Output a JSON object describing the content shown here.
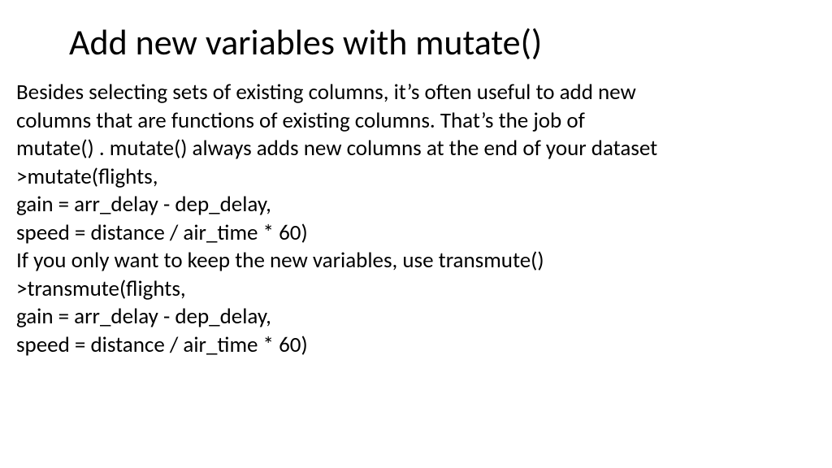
{
  "title": "Add new variables with mutate()",
  "lines": [
    "Besides selecting sets of existing columns, it’s often useful to add new",
    "columns that are functions of existing columns. That’s the job of",
    "mutate() . mutate() always adds new columns at the end of your dataset",
    ">mutate(flights,",
    "gain = arr_delay - dep_delay,",
    "speed = distance / air_time * 60)",
    "If you only want to keep the new variables, use transmute()",
    ">transmute(flights,",
    "gain = arr_delay - dep_delay,",
    "speed = distance / air_time * 60)"
  ]
}
